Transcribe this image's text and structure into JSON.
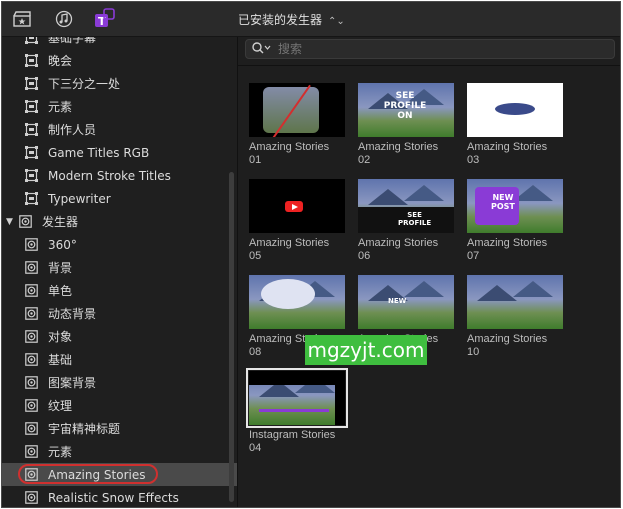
{
  "topbar": {
    "title": "已安装的发生器",
    "chevron": "⌃⌄",
    "icons": [
      "clapper-star-icon",
      "music-note-icon",
      "titles-icon"
    ]
  },
  "search": {
    "placeholder": "搜索",
    "value": ""
  },
  "sidebar": {
    "items": [
      {
        "label": "基础字幕",
        "level": 1,
        "icon": "title-icon"
      },
      {
        "label": "晚会",
        "level": 1,
        "icon": "title-icon"
      },
      {
        "label": "下三分之一处",
        "level": 1,
        "icon": "title-icon"
      },
      {
        "label": "元素",
        "level": 1,
        "icon": "title-icon"
      },
      {
        "label": "制作人员",
        "level": 1,
        "icon": "title-icon"
      },
      {
        "label": "Game Titles RGB",
        "level": 1,
        "icon": "title-icon"
      },
      {
        "label": "Modern Stroke Titles",
        "level": 1,
        "icon": "title-icon"
      },
      {
        "label": "Typewriter",
        "level": 1,
        "icon": "title-icon"
      },
      {
        "label": "发生器",
        "level": 0,
        "icon": "generator-icon",
        "disclosure": "▼"
      },
      {
        "label": "360°",
        "level": 1,
        "icon": "generator-icon"
      },
      {
        "label": "背景",
        "level": 1,
        "icon": "generator-icon"
      },
      {
        "label": "单色",
        "level": 1,
        "icon": "generator-icon"
      },
      {
        "label": "动态背景",
        "level": 1,
        "icon": "generator-icon"
      },
      {
        "label": "对象",
        "level": 1,
        "icon": "generator-icon"
      },
      {
        "label": "基础",
        "level": 1,
        "icon": "generator-icon"
      },
      {
        "label": "图案背景",
        "level": 1,
        "icon": "generator-icon"
      },
      {
        "label": "纹理",
        "level": 1,
        "icon": "generator-icon"
      },
      {
        "label": "宇宙精神标题",
        "level": 1,
        "icon": "generator-icon"
      },
      {
        "label": "元素",
        "level": 1,
        "icon": "generator-icon"
      },
      {
        "label": "Amazing Stories",
        "level": 1,
        "icon": "generator-icon",
        "selected": true
      },
      {
        "label": "Realistic Snow Effects",
        "level": 1,
        "icon": "generator-icon"
      }
    ]
  },
  "tiles": [
    {
      "name": "Amazing Stories\n01",
      "style": "phone"
    },
    {
      "name": "Amazing Stories\n02",
      "style": "see-profile"
    },
    {
      "name": "Amazing Stories\n03",
      "style": "white-oval"
    },
    {
      "name": "Amazing Stories\n05",
      "style": "youtube"
    },
    {
      "name": "Amazing Stories\n06",
      "style": "tiktok"
    },
    {
      "name": "Amazing Stories\n07",
      "style": "new-post"
    },
    {
      "name": "Amazing Stories\n08",
      "style": "bubble"
    },
    {
      "name": "Amazing Stories\n09",
      "style": "post-new"
    },
    {
      "name": "Amazing Stories\n10",
      "style": "landscape"
    },
    {
      "name": "Instagram Stories\n04",
      "style": "instagram",
      "selected": true
    }
  ],
  "watermark": "mgzyjt.com",
  "colors": {
    "selection_ring": "#d0302f",
    "watermark_bg": "#3fbe3f",
    "titles_icon_accent": "#8a3bd6"
  }
}
